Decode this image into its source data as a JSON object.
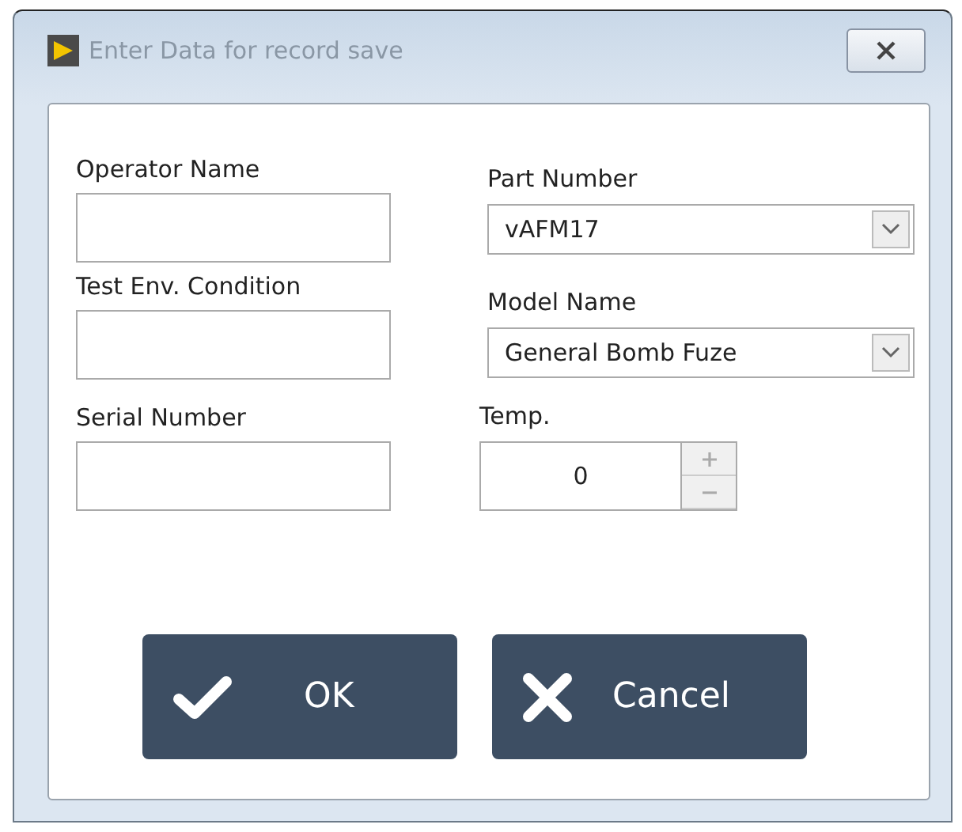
{
  "window": {
    "title": "Enter Data for record save"
  },
  "left_fields": [
    {
      "label": "Operator Name"
    },
    {
      "label": "Test Env. Condition"
    },
    {
      "label": "Serial Number"
    }
  ],
  "right_fields": [
    {
      "label": "Part Number",
      "kind": "dropdown",
      "value": "vAFM17"
    },
    {
      "label": "Model Name",
      "kind": "dropdown",
      "value": "General Bomb Fuze"
    },
    {
      "label": "Temp.",
      "kind": "spinner",
      "value": "0"
    }
  ],
  "buttons": [
    {
      "label": "OK",
      "kind": "ok"
    },
    {
      "label": "Cancel",
      "kind": "cancel"
    }
  ]
}
